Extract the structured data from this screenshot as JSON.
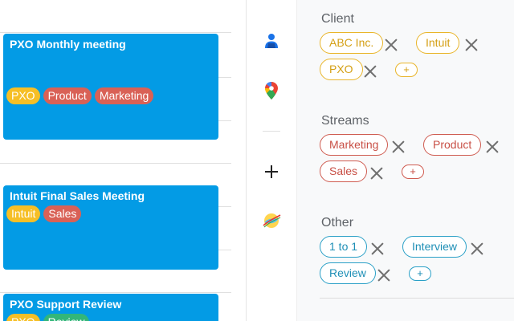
{
  "calendar": {
    "events": [
      {
        "title": "PXO Monthly meeting",
        "tags": [
          "PXO",
          "Product",
          "Marketing"
        ]
      },
      {
        "title": "Intuit Final Sales Meeting",
        "tags": [
          "Intuit",
          "Sales"
        ]
      },
      {
        "title": "PXO Support Review",
        "tags": [
          "PXO",
          "Review"
        ]
      }
    ]
  },
  "rail": {
    "icons": [
      "contacts-icon",
      "maps-pin-icon",
      "add-icon",
      "addon-icon"
    ]
  },
  "panel": {
    "sections": [
      {
        "title": "Client",
        "chips": [
          "ABC Inc.",
          "Intuit",
          "PXO"
        ],
        "add": "+"
      },
      {
        "title": "Streams",
        "chips": [
          "Marketing",
          "Product",
          "Sales"
        ],
        "add": "+"
      },
      {
        "title": "Other",
        "chips": [
          "1 to 1",
          "Interview",
          "Review"
        ],
        "add": "+"
      }
    ]
  },
  "colors": {
    "event_bg": "#039be5",
    "client": "#e9b52a",
    "stream": "#cf5b50",
    "other": "#2aa0c7"
  }
}
